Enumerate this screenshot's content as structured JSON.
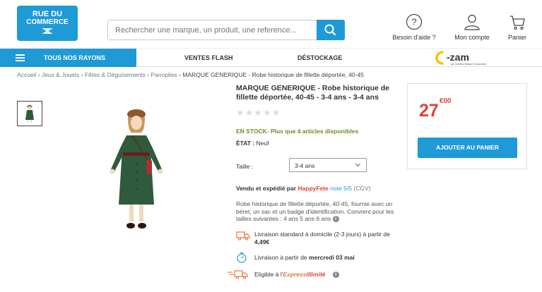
{
  "header": {
    "logo_line1": "RUE DU",
    "logo_line2": "COMMERCE",
    "search_placeholder": "Rechercher une marque, un produit, une reference...",
    "help_label": "Besoin d'aide ?",
    "account_label": "Mon compte",
    "cart_label": "Panier"
  },
  "nav": {
    "all_label": "TOUS NOS RAYONS",
    "items": [
      "VENTES FLASH",
      "DÉSTOCKAGE"
    ],
    "promo_name": "C-zam",
    "promo_tagline": "par Carrefour Banque et Assurance"
  },
  "breadcrumb": {
    "items": [
      "Accueil",
      "Jeux & Jouets",
      "Fêtes & Déguisements",
      "Panoplies"
    ],
    "current": "MARQUE GENERIQUE - Robe historique de fillette déportée, 40-45"
  },
  "product": {
    "title": "MARQUE GENERIQUE - Robe historique de fillette déportée, 40-45 - 3-4 ans - 3-4 ans",
    "rating_stars": "★★★★★",
    "rating": 0,
    "stock": "EN STOCK- Plus que 4 articles disponibles",
    "etat_label": "ÉTAT :",
    "etat_value": "Neuf",
    "size_label": "Taille :",
    "size_value": "3-4 ans",
    "sold_prefix": "Vendu et expédié par",
    "seller": "HappyFete",
    "seller_note": "note 5/5",
    "cgv": "(CGV)",
    "description": "Robe historique de fillette déportée, 40-45, fournie avec un béret, un sac et un badge d'identification. Convient pour les tailles suivantes : 4 ans 5 ans 6 ans",
    "delivery_standard": "Livraison standard à domicile (2-3 jours) à partir de",
    "delivery_standard_price": "4,49€",
    "delivery_date_prefix": "Livraison à partir de",
    "delivery_date": "mercredi 03 mai",
    "express_prefix": "Eligible à l'",
    "express_brand_1": "Express",
    "express_brand_2": "illimité"
  },
  "purchase": {
    "price_main": "27",
    "price_cents": "€00",
    "add_to_cart": "AJOUTER AU PANIER"
  },
  "colors": {
    "brand_blue": "#1e9ad6",
    "price_red": "#e0413a",
    "stock_green": "#6b8e23"
  }
}
